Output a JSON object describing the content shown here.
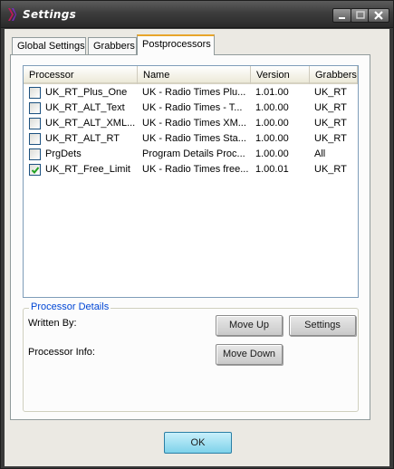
{
  "window": {
    "title": "Settings"
  },
  "tabs": [
    {
      "label": "Global Settings",
      "active": false
    },
    {
      "label": "Grabbers",
      "active": false
    },
    {
      "label": "Postprocessors",
      "active": true
    }
  ],
  "processor_list": {
    "columns": [
      "Processor",
      "Name",
      "Version",
      "Grabbers"
    ],
    "rows": [
      {
        "processor": "UK_RT_Plus_One",
        "name": "UK - Radio Times Plu...",
        "version": "1.01.00",
        "grabbers": "UK_RT",
        "checked": false
      },
      {
        "processor": "UK_RT_ALT_Text",
        "name": "UK - Radio Times - T...",
        "version": "1.00.00",
        "grabbers": "UK_RT",
        "checked": false
      },
      {
        "processor": "UK_RT_ALT_XML...",
        "name": "UK - Radio Times XM...",
        "version": "1.00.00",
        "grabbers": "UK_RT",
        "checked": false
      },
      {
        "processor": "UK_RT_ALT_RT",
        "name": "UK - Radio Times Sta...",
        "version": "1.00.00",
        "grabbers": "UK_RT",
        "checked": false
      },
      {
        "processor": "PrgDets",
        "name": "Program Details Proc...",
        "version": "1.00.00",
        "grabbers": "All",
        "checked": false
      },
      {
        "processor": "UK_RT_Free_Limit",
        "name": "UK - Radio Times free...",
        "version": "1.00.01",
        "grabbers": "UK_RT",
        "checked": true
      }
    ]
  },
  "details": {
    "legend": "Processor Details",
    "written_by_label": "Written By:",
    "processor_info_label": "Processor Info:",
    "move_up_label": "Move Up",
    "settings_label": "Settings",
    "move_down_label": "Move Down"
  },
  "footer": {
    "ok_label": "OK"
  },
  "colors": {
    "titlebar": "#3d3d3d",
    "tab_highlight": "#e7a52a",
    "legend_text": "#0046d5",
    "ok_button": "#7ed2ea"
  }
}
